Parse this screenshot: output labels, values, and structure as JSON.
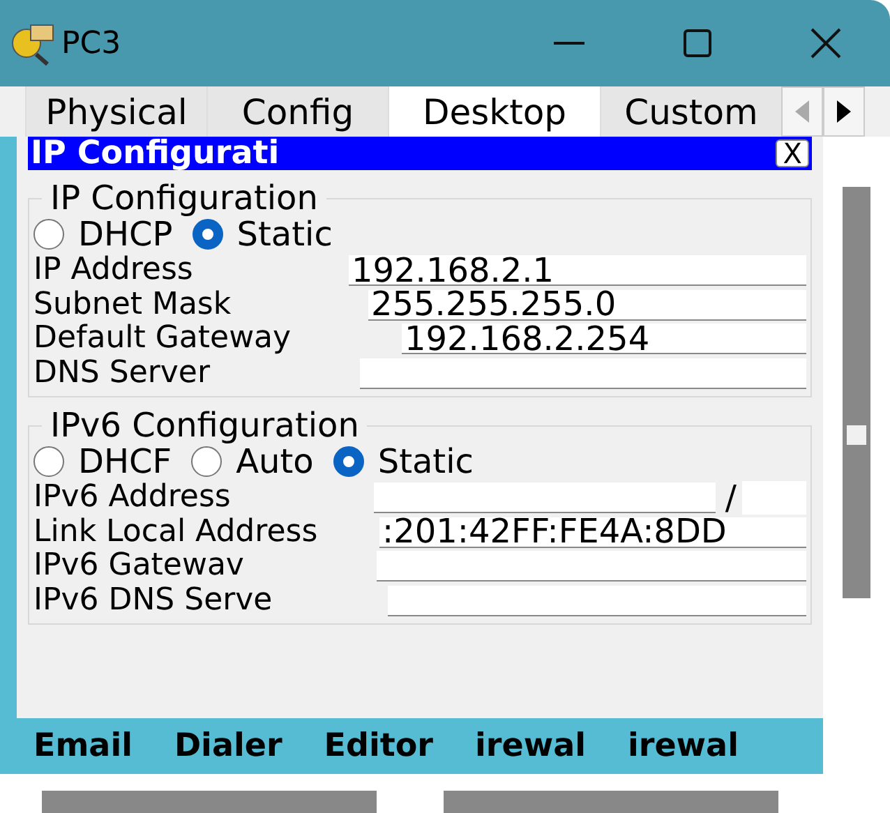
{
  "window": {
    "title": "PC3"
  },
  "tabs": [
    {
      "label": "Physical",
      "selected": false
    },
    {
      "label": "Config",
      "selected": false
    },
    {
      "label": "Desktop",
      "selected": true
    },
    {
      "label": "Custom",
      "selected": false
    }
  ],
  "dialog": {
    "title": "IP Configurati",
    "close": "X"
  },
  "ipv4": {
    "title": "IP Configuration",
    "modes": [
      {
        "label": "DHCP",
        "selected": false
      },
      {
        "label": "Static",
        "selected": true
      }
    ],
    "fields": [
      {
        "label": "IP Address",
        "value": "192.168.2.1"
      },
      {
        "label": "Subnet Mask",
        "value": "255.255.255.0"
      },
      {
        "label": "Default Gateway",
        "value": "192.168.2.254"
      },
      {
        "label": "DNS Server"
      }
    ]
  },
  "ipv6": {
    "title": "IPv6 Configuration",
    "modes": [
      {
        "label": "DHCF",
        "selected": false
      },
      {
        "label": "Auto",
        "selected": false
      },
      {
        "label": "Static",
        "selected": true
      }
    ],
    "fields": [
      {
        "label": "IPv6 Address",
        "kind": "prefix",
        "separator": "/"
      },
      {
        "label": "Link Local Address",
        "value": ":201:42FF:FE4A:8DD"
      },
      {
        "label": "IPv6 Gatewav"
      },
      {
        "label": "IPv6 DNS Serve"
      }
    ]
  },
  "apps": [
    "Email",
    "Dialer",
    "Editor",
    "irewal",
    "irewal"
  ]
}
